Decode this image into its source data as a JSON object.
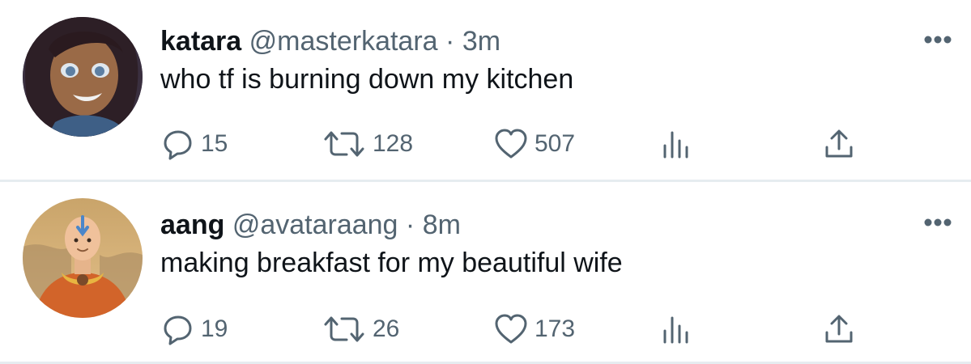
{
  "tweets": [
    {
      "name": "katara",
      "handle": "@masterkatara",
      "separator": "·",
      "time": "3m",
      "text": "who tf is burning down my kitchen",
      "replies": "15",
      "retweets": "128",
      "likes": "507",
      "avatar_icon": "katara-avatar"
    },
    {
      "name": "aang",
      "handle": "@avataraang",
      "separator": "·",
      "time": "8m",
      "text": "making breakfast for my beautiful wife",
      "replies": "19",
      "retweets": "26",
      "likes": "173",
      "avatar_icon": "aang-avatar"
    }
  ],
  "icons": {
    "reply": "reply-icon",
    "retweet": "retweet-icon",
    "like": "heart-icon",
    "views": "views-icon",
    "share": "share-icon",
    "more": "more-icon"
  },
  "colors": {
    "text": "#0f1419",
    "secondary": "#536471",
    "divider": "#e6ecf0"
  }
}
